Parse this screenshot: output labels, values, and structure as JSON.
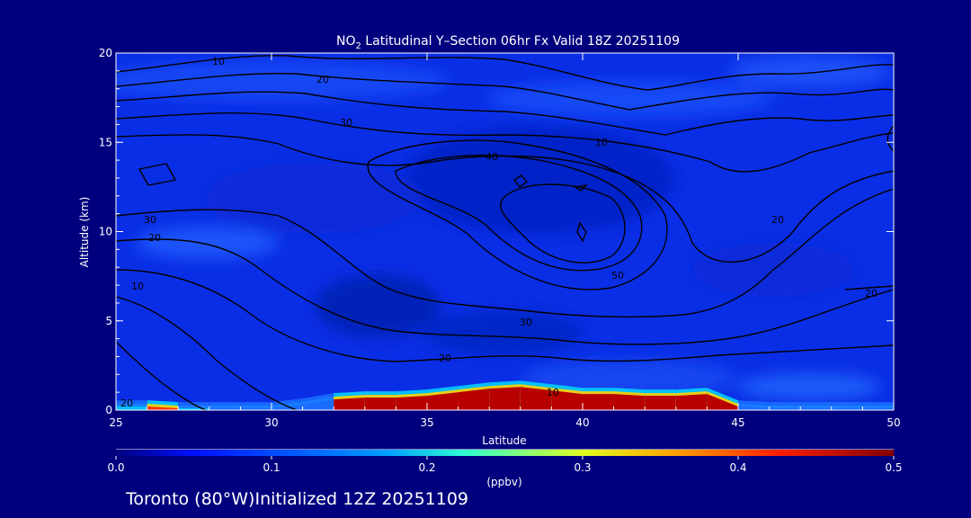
{
  "chart_data": {
    "type": "heatmap",
    "title": {
      "pre": "NO",
      "sub": "2",
      "post": " Latitudinal Y–Section 06hr  Fx Valid 18Z 20251109"
    },
    "xlabel": "Latitude",
    "ylabel": "Altitude (km)",
    "xlim": [
      25,
      50
    ],
    "ylim": [
      0,
      20
    ],
    "x_ticks": [
      "25",
      "30",
      "35",
      "40",
      "45",
      "50"
    ],
    "y_ticks": [
      "0",
      "5",
      "10",
      "15",
      "20"
    ],
    "colorbar": {
      "label": "(ppbv)",
      "range": [
        0.0,
        0.5
      ],
      "ticks": [
        "0.0",
        "0.1",
        "0.2",
        "0.3",
        "0.4",
        "0.5"
      ]
    },
    "near_surface_no2": {
      "description_units": "ppbv at ~0–1.5 km",
      "x": [
        25,
        26,
        27,
        28,
        29,
        30,
        31,
        32,
        33,
        34,
        35,
        36,
        37,
        38,
        39,
        40,
        41,
        42,
        43,
        44,
        45,
        46,
        47,
        48,
        49,
        50
      ],
      "values": [
        0.2,
        0.3,
        0.15,
        0.1,
        0.08,
        0.08,
        0.12,
        0.45,
        0.5,
        0.5,
        0.5,
        0.5,
        0.5,
        0.5,
        0.5,
        0.5,
        0.5,
        0.5,
        0.5,
        0.5,
        0.1,
        0.05,
        0.05,
        0.05,
        0.05,
        0.05
      ],
      "plume_top_km": [
        0.2,
        0.2,
        0.1,
        0.1,
        0.1,
        0.1,
        0.3,
        0.6,
        0.7,
        0.7,
        0.8,
        1.0,
        1.2,
        1.3,
        1.1,
        0.9,
        0.9,
        0.8,
        0.8,
        0.9,
        0.2,
        0.1,
        0.1,
        0.1,
        0.1,
        0.1
      ]
    },
    "contour_labels": [
      "10",
      "20",
      "30",
      "40",
      "50"
    ]
  },
  "footer": {
    "location": "Toronto (80°W)",
    "initialized": "Initialized 12Z 20251109"
  }
}
